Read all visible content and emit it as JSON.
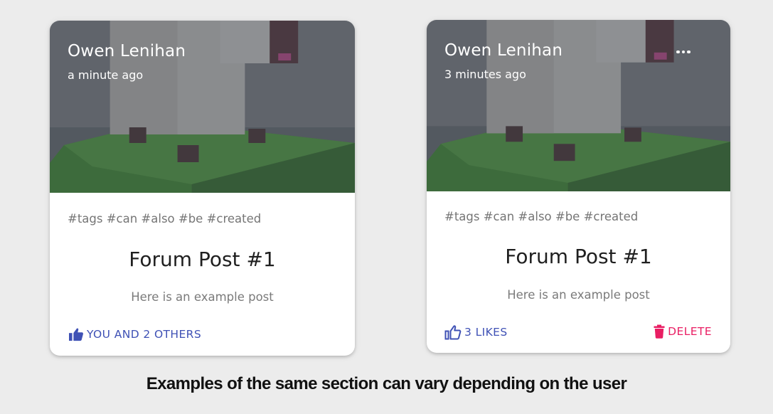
{
  "cards": [
    {
      "author": "Owen Lenihan",
      "time": "a minute ago",
      "tags": "#tags #can #also #be #created",
      "title": "Forum Post #1",
      "body": "Here is an example post",
      "like_label": "YOU AND 2 OTHERS",
      "like_state": "liked",
      "like_icon": "thumb-up-filled-icon"
    },
    {
      "author": "Owen Lenihan",
      "time": "3 minutes ago",
      "tags": "#tags #can #also #be #created",
      "title": "Forum Post #1",
      "body": "Here is an example post",
      "like_label": "3 LIKES",
      "like_state": "not-liked",
      "like_icon": "thumb-up-outline-icon",
      "more_icon": "more-horizontal-icon",
      "delete_label": "DELETE",
      "delete_icon": "trash-icon"
    }
  ],
  "caption": "Examples of the same section can vary depending on the user",
  "colors": {
    "page_background": "#ececec",
    "card_background": "#ffffff",
    "primary": "#3f51b5",
    "danger": "#e91e63",
    "image_overlay": "#3d424b"
  }
}
